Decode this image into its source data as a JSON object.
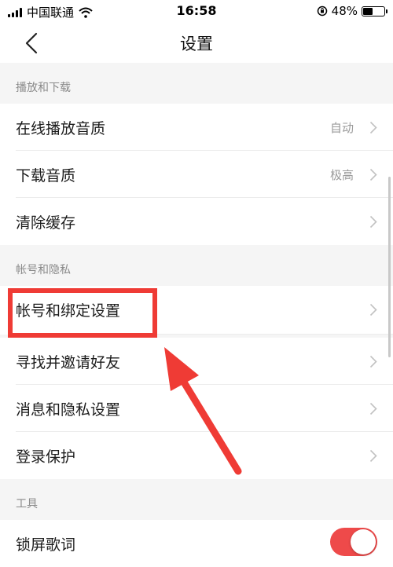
{
  "status_bar": {
    "carrier": "中国联通",
    "time": "16:58",
    "battery_percent": "48%",
    "battery_level": 0.48
  },
  "nav": {
    "title": "设置",
    "back_icon": "chevron-left-icon"
  },
  "sections": [
    {
      "header": "播放和下载",
      "rows": [
        {
          "label": "在线播放音质",
          "value": "自动"
        },
        {
          "label": "下载音质",
          "value": "极高"
        },
        {
          "label": "清除缓存",
          "value": ""
        }
      ]
    },
    {
      "header": "帐号和隐私",
      "rows": [
        {
          "label": "帐号和绑定设置",
          "value": ""
        },
        {
          "label": "寻找并邀请好友",
          "value": ""
        },
        {
          "label": "消息和隐私设置",
          "value": ""
        },
        {
          "label": "登录保护",
          "value": ""
        }
      ]
    },
    {
      "header": "工具",
      "rows": [
        {
          "label": "锁屏歌词",
          "toggle": true
        }
      ]
    }
  ],
  "colors": {
    "accent": "#ee4a4a",
    "annotation": "#ef3b35",
    "background": "#f5f5f5",
    "secondary_text": "#9a9a9a"
  }
}
